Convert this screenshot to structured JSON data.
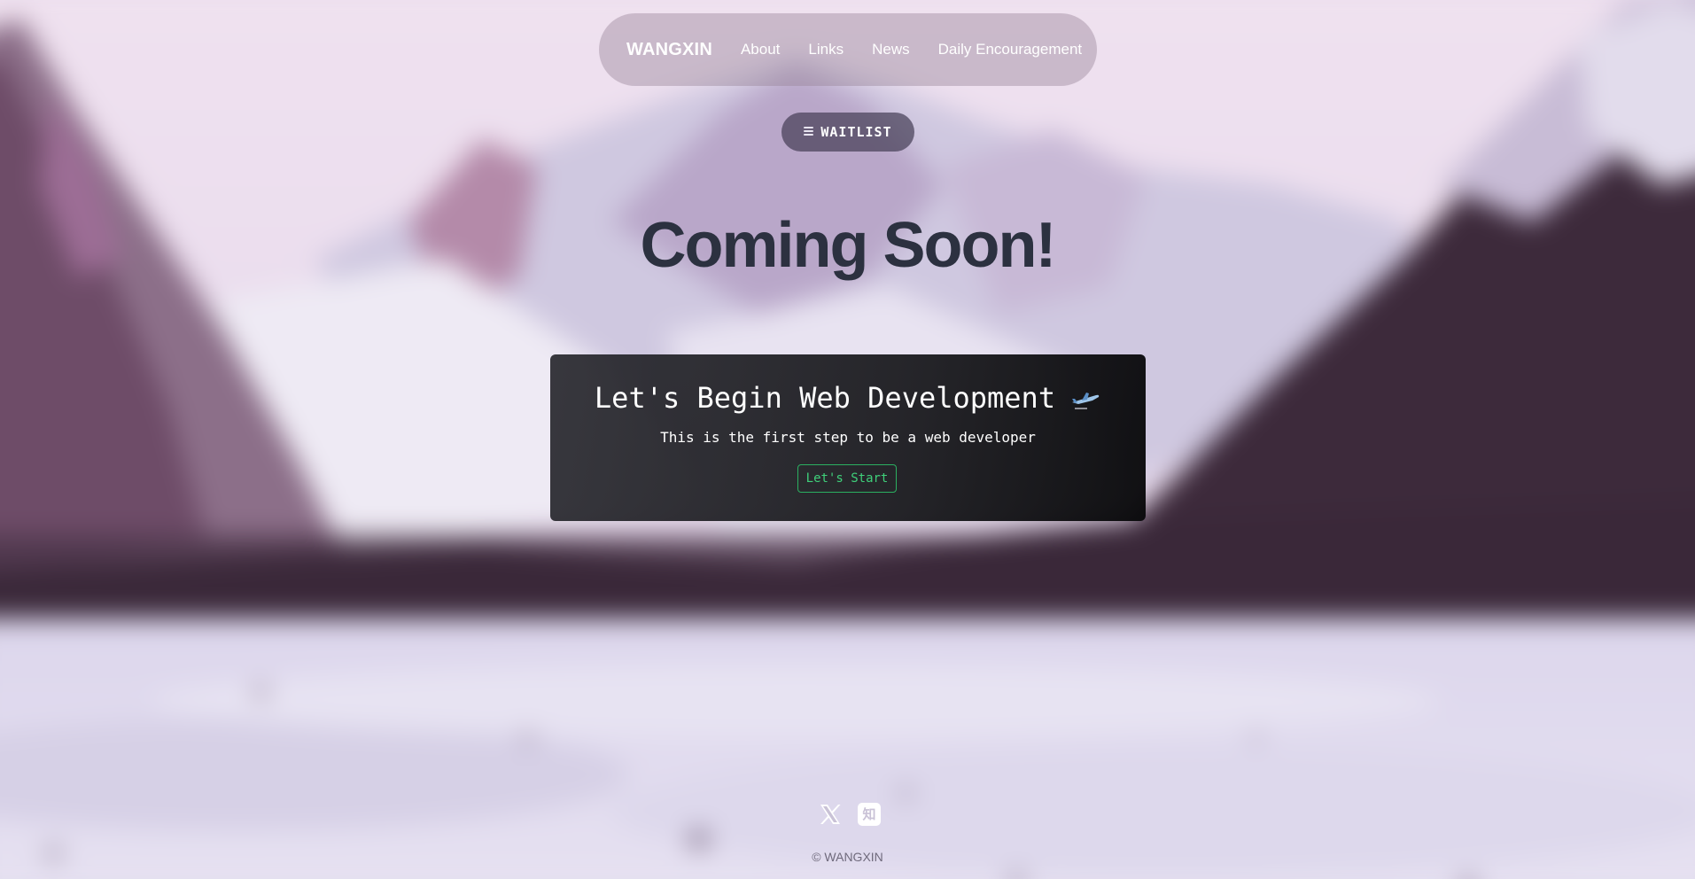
{
  "nav": {
    "brand": "WANGXIN",
    "links": [
      "About",
      "Links",
      "News",
      "Daily Encouragement"
    ]
  },
  "waitlist": {
    "label": "WAITLIST",
    "icon": "stack-icon"
  },
  "headline": "Coming Soon!",
  "card": {
    "title": "Let's Begin Web Development",
    "title_icon": "airplane-icon",
    "subtitle": "This is the first step to be a web developer",
    "button_label": "Let's Start"
  },
  "footer": {
    "social": [
      {
        "icon": "x-icon"
      },
      {
        "icon": "zhihu-icon",
        "glyph": "知"
      }
    ],
    "copyright": "© WANGXIN"
  },
  "colors": {
    "headline": "#2c3140",
    "button_accent": "#3fd07a",
    "card_bg": "#1c1c20"
  }
}
